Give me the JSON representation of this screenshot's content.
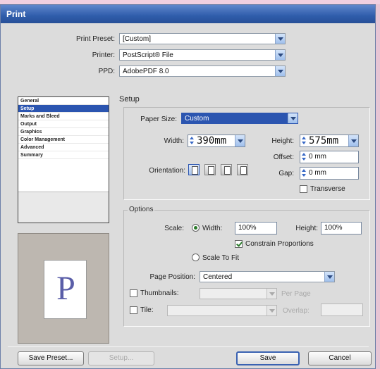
{
  "window": {
    "title": "Print"
  },
  "top": {
    "print_preset_label": "Print Preset:",
    "print_preset_value": "[Custom]",
    "printer_label": "Printer:",
    "printer_value": "PostScript® File",
    "ppd_label": "PPD:",
    "ppd_value": "AdobePDF 8.0"
  },
  "sidebar": {
    "items": [
      {
        "label": "General"
      },
      {
        "label": "Setup",
        "selected": true
      },
      {
        "label": "Marks and Bleed"
      },
      {
        "label": "Output"
      },
      {
        "label": "Graphics"
      },
      {
        "label": "Color Management"
      },
      {
        "label": "Advanced"
      },
      {
        "label": "Summary"
      }
    ]
  },
  "preview": {
    "letter": "P"
  },
  "setup": {
    "title": "Setup",
    "paper_size_label": "Paper Size:",
    "paper_size_value": "Custom",
    "width_label": "Width:",
    "width_value": "390mm",
    "height_label": "Height:",
    "height_value": "575mm",
    "offset_label": "Offset:",
    "offset_value": "0 mm",
    "gap_label": "Gap:",
    "gap_value": "0 mm",
    "orientation_label": "Orientation:",
    "transverse_label": "Transverse",
    "transverse_checked": false
  },
  "options": {
    "title": "Options",
    "scale_label": "Scale:",
    "width_radio_label": "Width:",
    "width_radio_selected": true,
    "scale_width_value": "100%",
    "height_label": "Height:",
    "scale_height_value": "100%",
    "constrain_label": "Constrain Proportions",
    "constrain_checked": true,
    "scale_to_fit_label": "Scale To Fit",
    "page_position_label": "Page Position:",
    "page_position_value": "Centered",
    "thumbnails_label": "Thumbnails:",
    "per_page_label": "Per Page",
    "tile_label": "Tile:",
    "overlap_label": "Overlap:"
  },
  "buttons": {
    "save_preset": "Save Preset...",
    "setup": "Setup...",
    "save": "Save",
    "cancel": "Cancel"
  },
  "colors": {
    "title_bar": "#2f5dab",
    "selection": "#2b55b0",
    "dialog_bg": "#dcdcdc",
    "desktop_bg": "#e7c4d4"
  }
}
